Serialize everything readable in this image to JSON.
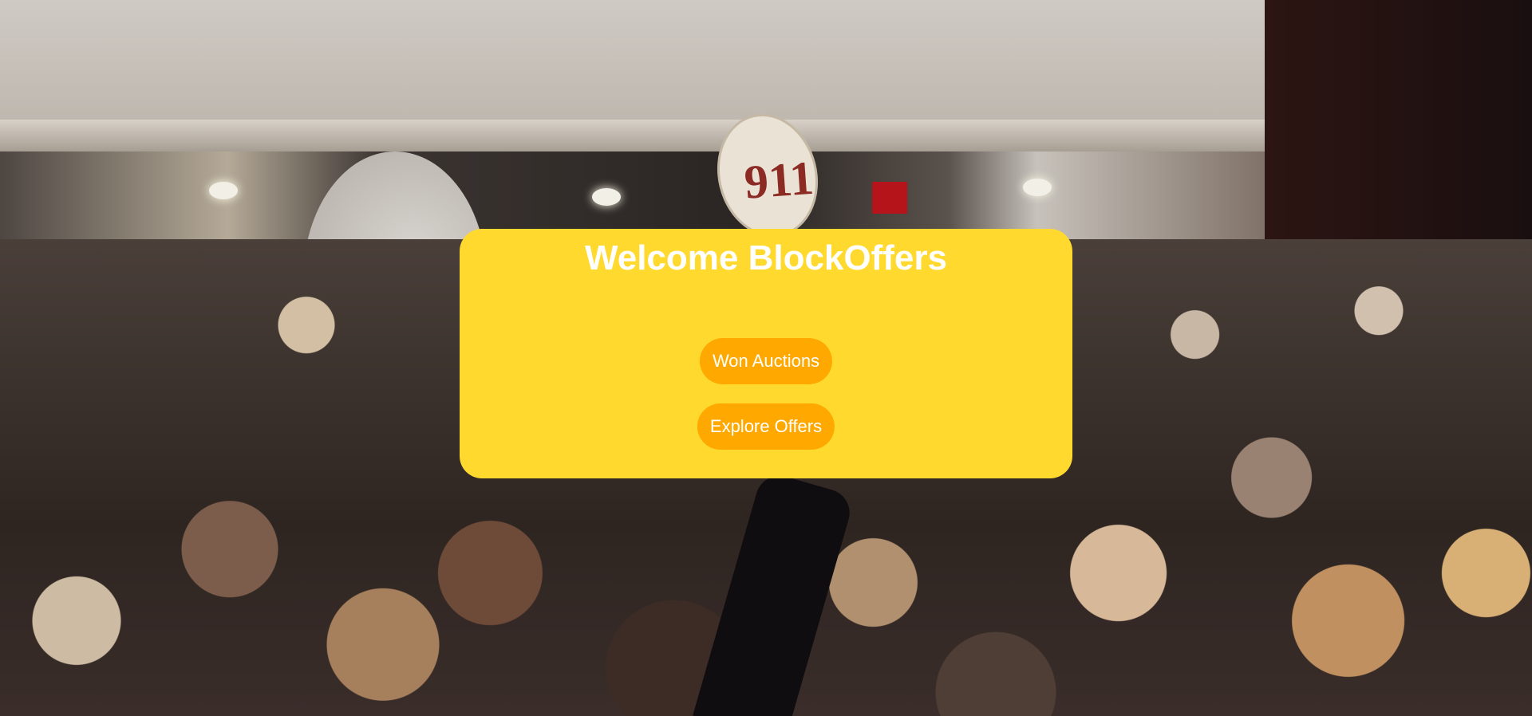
{
  "background": {
    "paddle_number": "911"
  },
  "panel": {
    "title": "Welcome BlockOffers",
    "color": "#ffd92e",
    "buttons": {
      "won_auctions": "Won Auctions",
      "explore_offers": "Explore Offers"
    },
    "button_color": "#ffa800"
  }
}
